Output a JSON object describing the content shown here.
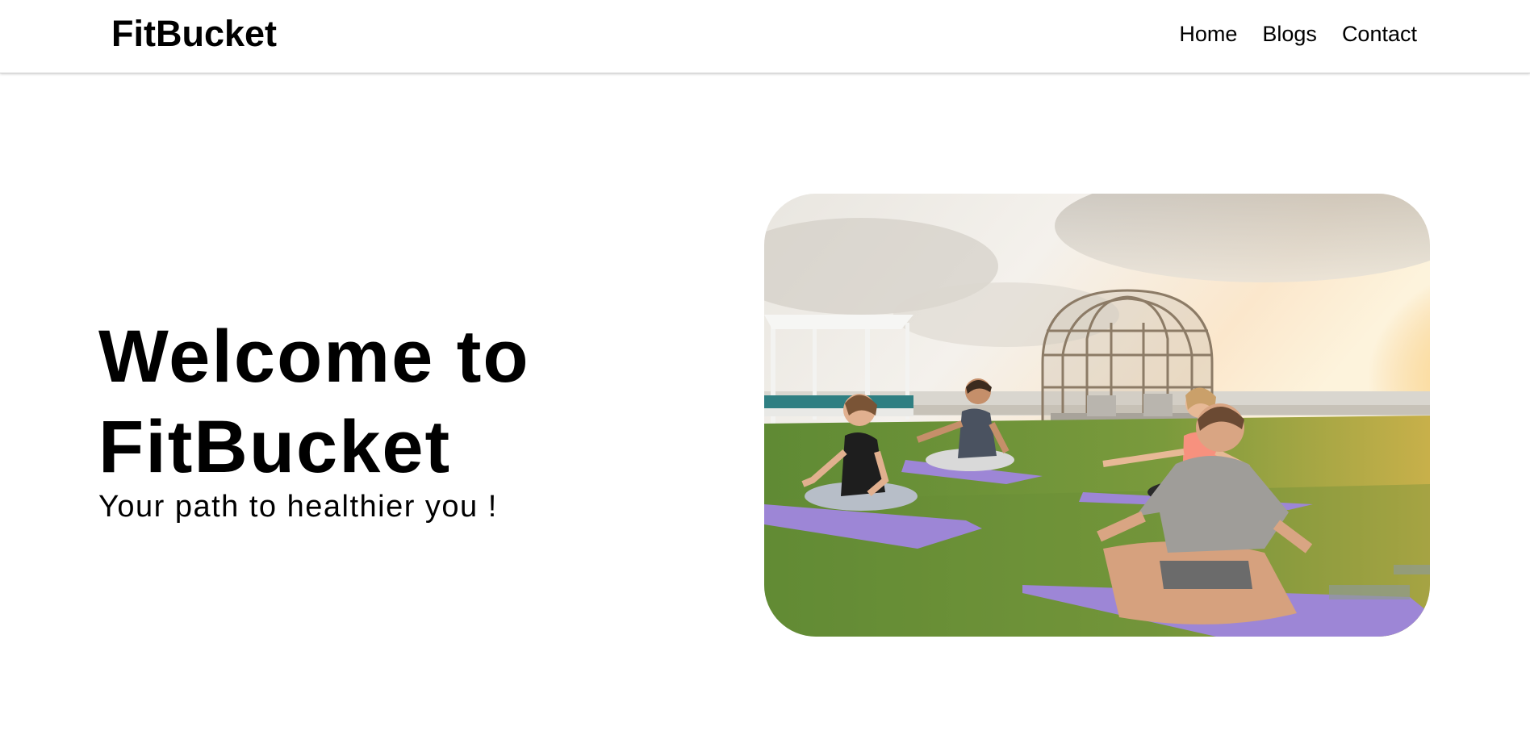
{
  "navbar": {
    "brand": "FitBucket",
    "links": [
      {
        "label": "Home"
      },
      {
        "label": "Blogs"
      },
      {
        "label": "Contact"
      }
    ]
  },
  "hero": {
    "title_line1": "Welcome to",
    "title_line2": "FitBucket",
    "subtitle": "Your path to healthier you !",
    "image_subject": "people-doing-yoga-on-purple-mats-on-rooftop-lawn-at-sunset"
  },
  "colors": {
    "background": "#ffffff",
    "text": "#000000",
    "nav_border": "#d0d0d0",
    "mat": "#9d86d6",
    "grass": "#6e8f3a"
  }
}
